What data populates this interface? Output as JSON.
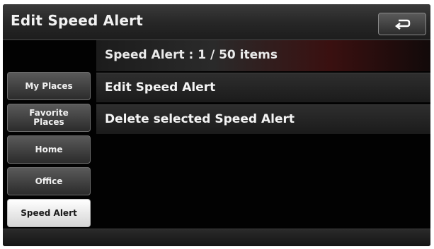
{
  "header": {
    "title": "Edit Speed Alert",
    "back_icon": "back-arrow-icon"
  },
  "summary": {
    "count_text": "Speed Alert : 1 / 50 items"
  },
  "sidebar": {
    "items": [
      {
        "label": "My Places",
        "active": false
      },
      {
        "label": "Favorite\nPlaces",
        "active": false
      },
      {
        "label": "Home",
        "active": false
      },
      {
        "label": "Office",
        "active": false
      },
      {
        "label": "Speed Alert",
        "active": true
      }
    ]
  },
  "menu": {
    "items": [
      {
        "label": "Edit Speed Alert"
      },
      {
        "label": "Delete selected Speed Alert"
      }
    ]
  },
  "colors": {
    "accent_red": "#3a1010",
    "active_tab": "#ffffff"
  }
}
